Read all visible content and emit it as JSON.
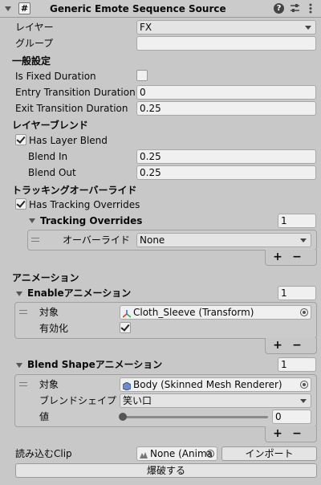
{
  "header": {
    "icon_text": "#",
    "title": "Generic Emote Sequence Source"
  },
  "layer": {
    "label": "レイヤー",
    "value": "FX"
  },
  "group": {
    "label": "グループ",
    "value": ""
  },
  "general": {
    "heading": "一般設定",
    "is_fixed_duration_label": "Is Fixed Duration",
    "entry_label": "Entry Transition Duration",
    "entry_value": "0",
    "exit_label": "Exit Transition Duration",
    "exit_value": "0.25"
  },
  "layer_blend": {
    "heading": "レイヤーブレンド",
    "has_label": "Has Layer Blend",
    "blend_in_label": "Blend In",
    "blend_in_value": "0.25",
    "blend_out_label": "Blend Out",
    "blend_out_value": "0.25"
  },
  "tracking": {
    "heading": "トラッキングオーバーライド",
    "has_label": "Has Tracking Overrides",
    "list_title": "Tracking Overrides",
    "count": "1",
    "item_label": "オーバーライド",
    "item_value": "None"
  },
  "animation": {
    "heading": "アニメーション",
    "enable": {
      "title": "Enableアニメーション",
      "count": "1",
      "target_label": "対象",
      "target_value": "Cloth_Sleeve (Transform)",
      "enabled_label": "有効化"
    },
    "blendshape": {
      "title": "Blend Shapeアニメーション",
      "count": "1",
      "target_label": "対象",
      "target_value": "Body (Skinned Mesh Renderer)",
      "shape_label": "ブレンドシェイプ",
      "shape_value": "笑い口",
      "value_label": "値",
      "value": "0"
    }
  },
  "clip": {
    "label": "読み込むClip",
    "value": "None (Anima",
    "import_label": "インポート"
  },
  "explode_label": "爆破する",
  "plus": "+",
  "minus": "−"
}
